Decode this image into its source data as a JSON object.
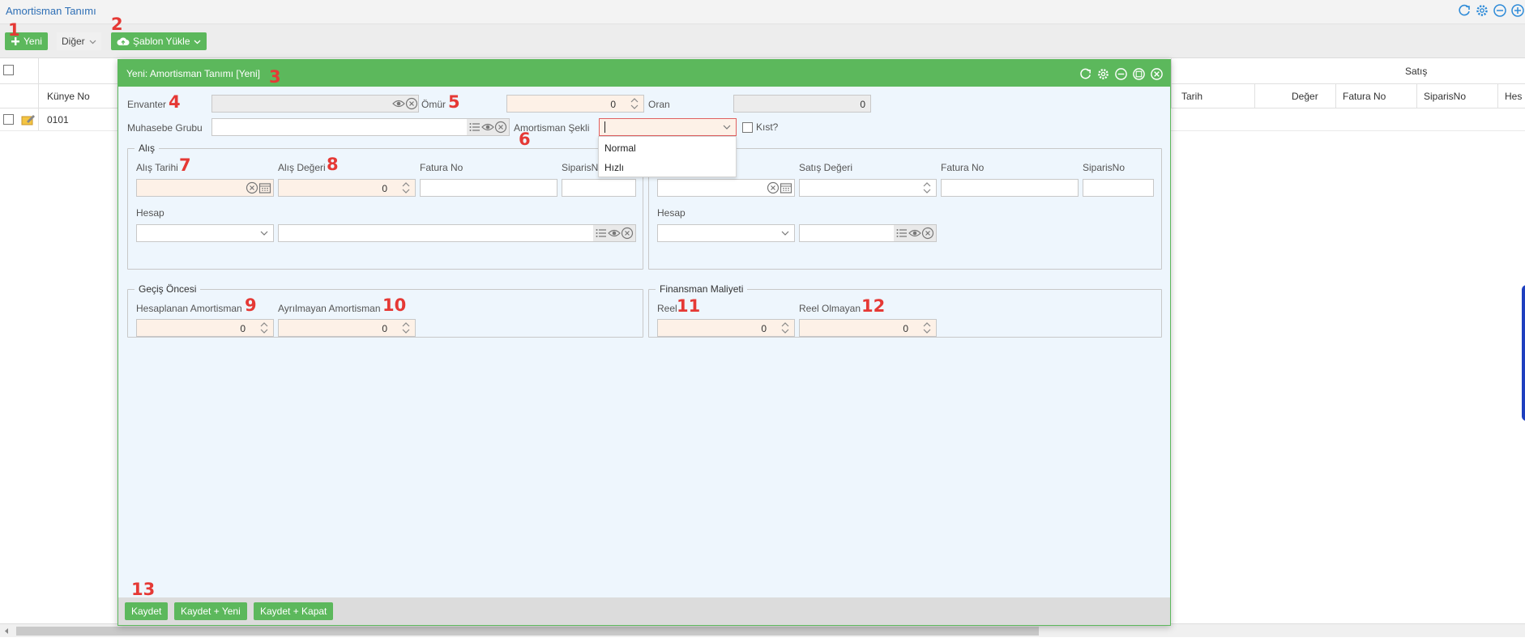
{
  "app": {
    "title": "Amortisman Tanımı"
  },
  "toolbar": {
    "new_label": "Yeni",
    "other_label": "Diğer",
    "template_label": "Şablon Yükle"
  },
  "grid": {
    "group_header": "Satış",
    "columns": [
      "Künye No",
      "Tarih",
      "Değer",
      "Fatura No",
      "SiparisNo",
      "Hes"
    ],
    "rows": [
      {
        "kunye_no": "0101"
      }
    ]
  },
  "modal": {
    "title": "Yeni: Amortisman Tanımı [Yeni]",
    "fields": {
      "envanter": {
        "label": "Envanter",
        "value": ""
      },
      "omur": {
        "label": "Ömür",
        "value": "0"
      },
      "oran": {
        "label": "Oran",
        "value": "0"
      },
      "muhasebe_grubu": {
        "label": "Muhasebe Grubu",
        "value": ""
      },
      "amortisman_sekli": {
        "label": "Amortisman Şekli",
        "value": "",
        "options": [
          "Normal",
          "Hızlı"
        ]
      },
      "kist": {
        "label": "Kıst?",
        "checked": false
      }
    },
    "alis": {
      "title": "Alış",
      "alis_tarihi": {
        "label": "Alış Tarihi",
        "value": ""
      },
      "alis_degeri": {
        "label": "Alış Değeri",
        "value": "0"
      },
      "fatura_no": {
        "label": "Fatura No",
        "value": ""
      },
      "siparis_no": {
        "label": "SiparisNo",
        "value": ""
      },
      "hesap": {
        "label": "Hesap",
        "value": ""
      }
    },
    "satis": {
      "satis_degeri": {
        "label": "Satış Değeri",
        "value": ""
      },
      "fatura_no": {
        "label": "Fatura No",
        "value": ""
      },
      "siparis_no": {
        "label": "SiparisNo",
        "value": ""
      },
      "hesap": {
        "label": "Hesap",
        "value": ""
      }
    },
    "gecis_oncesi": {
      "title": "Geçiş Öncesi",
      "hesaplanan": {
        "label": "Hesaplanan Amortisman",
        "value": "0"
      },
      "ayrilmayan": {
        "label": "Ayrılmayan Amortisman",
        "value": "0"
      }
    },
    "finansman": {
      "title": "Finansman Maliyeti",
      "reel": {
        "label": "Reel",
        "value": "0"
      },
      "reel_olmayan": {
        "label": "Reel Olmayan",
        "value": "0"
      }
    },
    "footer": {
      "save": "Kaydet",
      "save_new": "Kaydet + Yeni",
      "save_close": "Kaydet + Kapat"
    }
  },
  "markers": [
    "1",
    "2",
    "3",
    "4",
    "5",
    "6",
    "7",
    "8",
    "9",
    "10",
    "11",
    "12",
    "13"
  ],
  "colors": {
    "accent": "#5cb85c",
    "link": "#2e6fb5",
    "marker": "#e53935",
    "required_bg": "#fdf1e7",
    "modal_bg": "#eef6fd"
  }
}
